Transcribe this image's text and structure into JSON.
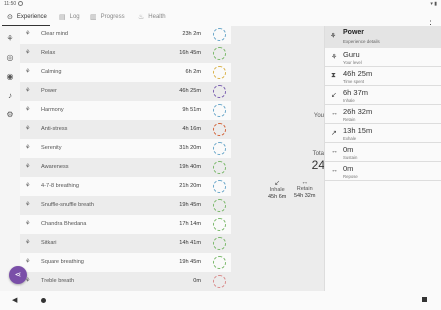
{
  "status": {
    "time": "11:50",
    "right": "▾ ▮"
  },
  "tabs": [
    {
      "label": "Experience",
      "icon": "⊙",
      "icon_name": "target-icon"
    },
    {
      "label": "Log",
      "icon": "▤",
      "icon_name": "log-icon"
    },
    {
      "label": "Progress",
      "icon": "▥",
      "icon_name": "progress-chart-icon"
    },
    {
      "label": "Health",
      "icon": "♨",
      "icon_name": "health-icon"
    }
  ],
  "menu": {
    "icon": "⋮"
  },
  "rail": [
    {
      "icon": "⚘",
      "name": "meditation-icon"
    },
    {
      "icon": "◎",
      "name": "compass-icon"
    },
    {
      "icon": "◉",
      "name": "target-icon"
    },
    {
      "icon": "♪",
      "name": "bell-icon"
    },
    {
      "icon": "⚙",
      "name": "sliders-icon"
    }
  ],
  "exercises": [
    {
      "name": "Clear mind",
      "time": "23h 2m",
      "badge_color": "#6aa7c9"
    },
    {
      "name": "Relax",
      "time": "16h 45m",
      "badge_color": "#7ab86a"
    },
    {
      "name": "Calming",
      "time": "6h 2m",
      "badge_color": "#d9b24a"
    },
    {
      "name": "Power",
      "time": "46h 25m",
      "badge_color": "#7a5fb0"
    },
    {
      "name": "Harmony",
      "time": "9h 51m",
      "badge_color": "#6aa7c9"
    },
    {
      "name": "Anti-stress",
      "time": "4h 16m",
      "badge_color": "#d2643a"
    },
    {
      "name": "Serenity",
      "time": "31h 20m",
      "badge_color": "#6aa7c9"
    },
    {
      "name": "Awareness",
      "time": "19h 40m",
      "badge_color": "#7ab86a"
    },
    {
      "name": "4-7-8 breathing",
      "time": "21h 20m",
      "badge_color": "#6aa7c9"
    },
    {
      "name": "Snuffle-snuffle breath",
      "time": "19h 45m",
      "badge_color": "#7ab86a"
    },
    {
      "name": "Chandra Bhedana",
      "time": "17h 14m",
      "badge_color": "#7ab86a"
    },
    {
      "name": "Sitkari",
      "time": "14h 41m",
      "badge_color": "#7ab86a"
    },
    {
      "name": "Square breathing",
      "time": "19h 45m",
      "badge_color": "#7ab86a"
    },
    {
      "name": "Treble breath",
      "time": "0m",
      "badge_color": "#d98a8a"
    }
  ],
  "middle": {
    "you_label": "You",
    "total_label": "Tota",
    "total_value": "24",
    "inhale_label": "Inhale",
    "inhale_value": "45h 6m",
    "retain_label": "Retain",
    "retain_value": "54h 32m"
  },
  "panel": {
    "title": "Power",
    "subtitle": "Experience details",
    "items": [
      {
        "icon": "⚘",
        "icon_name": "level-icon",
        "value": "Guru",
        "label": "Your level"
      },
      {
        "icon": "⧗",
        "icon_name": "hourglass-icon",
        "value": "46h 25m",
        "label": "Time spent"
      },
      {
        "icon": "↙",
        "icon_name": "inhale-icon",
        "value": "6h 37m",
        "label": "Inhale"
      },
      {
        "icon": "↔",
        "icon_name": "retain-icon",
        "value": "26h 32m",
        "label": "Retain"
      },
      {
        "icon": "↗",
        "icon_name": "exhale-icon",
        "value": "13h 15m",
        "label": "Exhale"
      },
      {
        "icon": "↔",
        "icon_name": "sustain-icon",
        "value": "0m",
        "label": "Sustain"
      },
      {
        "icon": "↔",
        "icon_name": "repose-icon",
        "value": "0m",
        "label": "Repose"
      }
    ]
  },
  "fab": {
    "icon": "⋖"
  },
  "nav": {
    "back": "◀"
  }
}
